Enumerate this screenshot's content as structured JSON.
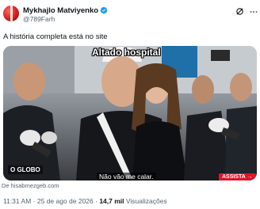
{
  "author": {
    "display_name": "Mykhajlo Matviyenko",
    "handle": "@789Farh",
    "verified": true,
    "avatar_icon": "avatar-flag-icon"
  },
  "tweet": {
    "text": "A história completa está no site"
  },
  "media": {
    "caption": "Altado hospital",
    "subtitle": "Não vão me calar.",
    "channel_logo": "O GLOBO",
    "watch_label": "ASSISTA →"
  },
  "source": "De hisabmezgeb.com",
  "meta": {
    "time": "11:31 AM",
    "separator": " · ",
    "date": "25 de ago de 2026",
    "views_count": "14,7 mil",
    "views_label": "Visualizações"
  },
  "colors": {
    "verified": "#1d9bf0",
    "text_secondary": "#536471",
    "watch_button": "#e0142a"
  }
}
